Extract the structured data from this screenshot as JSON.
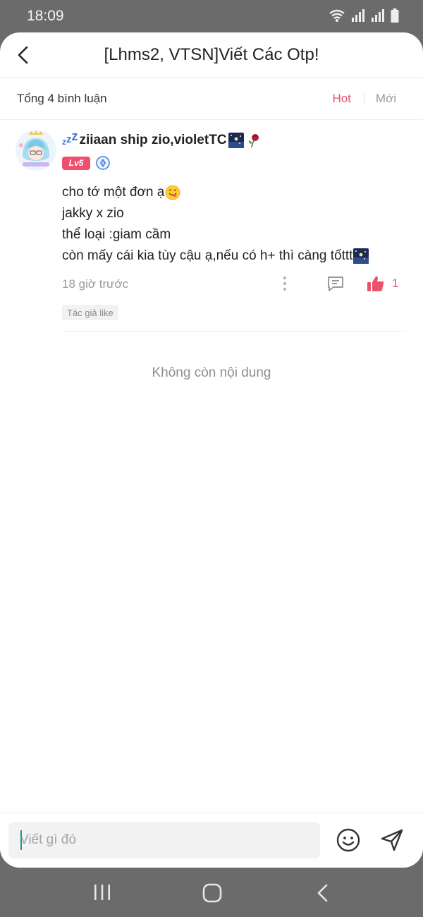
{
  "status_bar": {
    "time": "18:09"
  },
  "header": {
    "title": "[Lhms2, VTSN]Viết Các Otp!"
  },
  "subheader": {
    "comment_count": "Tổng 4 bình luận",
    "sort_hot": "Hot",
    "sort_new": "Mới"
  },
  "comment": {
    "username": "ziiaan ship zio,violetTC",
    "level": "Lv5",
    "lines": [
      "cho tớ một đơn ạ",
      "jakky x zio",
      "thể loại :giam cầm",
      "còn mấy cái kia tùy cậu ạ,nếu có h+ thì càng tốttt"
    ],
    "timestamp": "18 giờ trước",
    "like_count": "1",
    "author_tag": "Tác giả like"
  },
  "end_text": "Không còn nội dung",
  "input": {
    "placeholder": "Viết gì đó"
  },
  "colors": {
    "accent": "#e8536b",
    "level_badge": "#ef4f6e",
    "verified": "#3a7be0"
  }
}
